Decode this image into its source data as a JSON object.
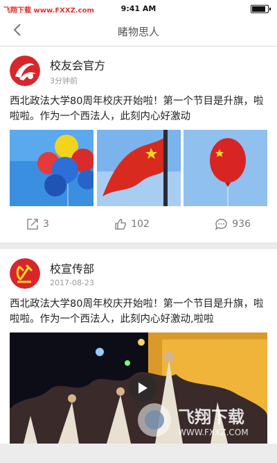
{
  "status": {
    "watermark": "飞翔下载 www.FXXZ.com",
    "time": "9:41 AM"
  },
  "nav": {
    "title": "睹物思人"
  },
  "posts": [
    {
      "author": "校友会官方",
      "time": "3分钟前",
      "text": "西北政法大学80周年校庆开始啦！第一个节目是升旗，啦啦啦。作为一个西法人，此刻内心好激动",
      "share_count": "3",
      "like_count": "102",
      "comment_count": "936"
    },
    {
      "author": "校宣传部",
      "time": "2017-08-23",
      "text": "西北政法大学80周年校庆开始啦！第一个节目是升旗，啦啦啦。作为一个西法人，此刻内心好激动,啦啦"
    }
  ],
  "watermark": {
    "brand": "飞翔下载",
    "url": "WWW.FXXZ.COM"
  },
  "icons": [
    "back-icon",
    "share-icon",
    "thumb-up-icon",
    "comment-icon",
    "play-icon"
  ],
  "colors": {
    "accent_red": "#d7262c",
    "sky_blue": "#4a90d9"
  }
}
